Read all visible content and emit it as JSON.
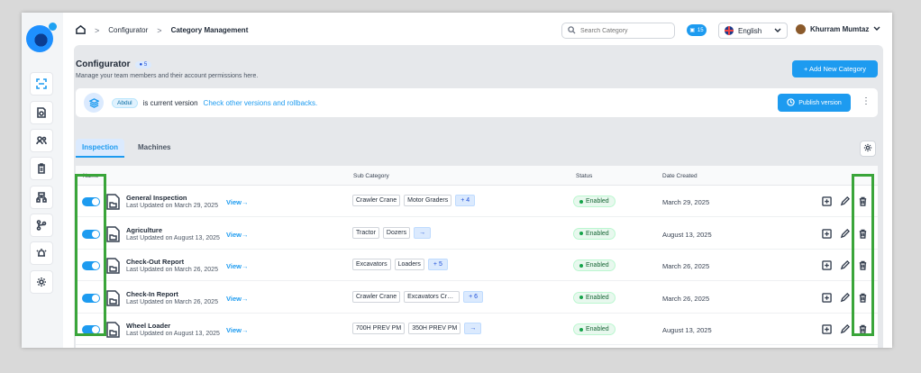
{
  "breadcrumb": {
    "items": [
      "Configurator",
      "Category Management"
    ]
  },
  "search": {
    "placeholder": "Search Category"
  },
  "notifications": {
    "count": "15"
  },
  "language": {
    "selected": "English"
  },
  "user": {
    "name": "Khurram Mumtaz"
  },
  "sidebar": {
    "items": [
      {
        "icon": "scan-icon",
        "active": true
      },
      {
        "icon": "report-search-icon"
      },
      {
        "icon": "users-icon"
      },
      {
        "icon": "clipboard-icon"
      },
      {
        "icon": "hierarchy-icon"
      },
      {
        "icon": "branch-icon"
      },
      {
        "icon": "alarm-icon"
      },
      {
        "icon": "settings-icon"
      }
    ]
  },
  "header": {
    "title": "Configurator",
    "count": "5",
    "subtitle": "Manage your team members and their account permissions here.",
    "add_button": "+ Add New Category"
  },
  "version": {
    "user": "Abdul",
    "text": "is current version",
    "link": "Check other versions and rollbacks.",
    "publish_button": "Publish version"
  },
  "tabs": [
    {
      "label": "Inspection",
      "active": true
    },
    {
      "label": "Machines",
      "active": false
    }
  ],
  "table": {
    "columns": [
      "Name",
      "Sub Category",
      "Status",
      "Date Created"
    ],
    "view_label": "View",
    "rows": [
      {
        "name": "General Inspection",
        "updated": "Last Updated on March 29, 2025",
        "subs": [
          "Crawler Crane",
          "Motor Graders"
        ],
        "more": "+ 4",
        "status": "Enabled",
        "date": "March 29, 2025"
      },
      {
        "name": "Agriculture",
        "updated": "Last Updated on August 13, 2025",
        "subs": [
          "Tractor",
          "Dozers"
        ],
        "more": "→",
        "status": "Enabled",
        "date": "August 13, 2025"
      },
      {
        "name": "Check-Out Report",
        "updated": "Last Updated on March 26, 2025",
        "subs": [
          "Excavators",
          "Loaders"
        ],
        "more": "+ 5",
        "status": "Enabled",
        "date": "March 26, 2025"
      },
      {
        "name": "Check-In Report",
        "updated": "Last Updated on March 26, 2025",
        "subs": [
          "Crawler Crane",
          "Excavators Crawler"
        ],
        "more": "+ 6",
        "status": "Enabled",
        "date": "March 26, 2025"
      },
      {
        "name": "Wheel Loader",
        "updated": "Last Updated on August 13, 2025",
        "subs": [
          "700H PREV PM",
          "350H PREV PM"
        ],
        "more": "→",
        "status": "Enabled",
        "date": "August 13, 2025"
      }
    ]
  },
  "colors": {
    "accent": "#1d9bf0",
    "highlight": "#3aa53a",
    "enabled": "#16a34a"
  }
}
